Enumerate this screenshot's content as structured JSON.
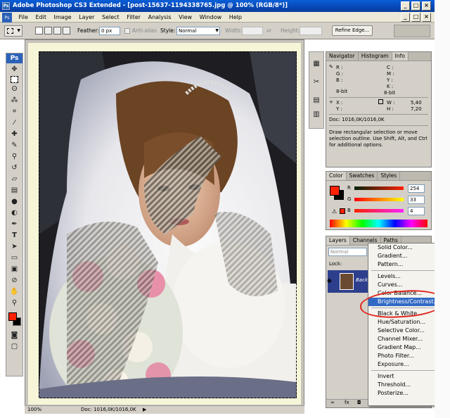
{
  "window": {
    "title": "Adobe Photoshop CS3 Extended - [post-15637-1194338765.jpg @ 100% (RGB/8*)]"
  },
  "menu": [
    "File",
    "Edit",
    "Image",
    "Layer",
    "Select",
    "Filter",
    "Analysis",
    "View",
    "Window",
    "Help"
  ],
  "options": {
    "feather_label": "Feather:",
    "feather_value": "0 px",
    "antialias_label": "Anti-alias",
    "style_label": "Style:",
    "style_value": "Normal",
    "width_label": "Width:",
    "height_label": "Height:",
    "refine_edge": "Refine Edge..."
  },
  "toolbox": {
    "logo": "Ps"
  },
  "status": {
    "zoom": "100%",
    "doc": "Doc: 1016,0K/1016,0K"
  },
  "info_panel": {
    "tabs": [
      "Navigator",
      "Histogram",
      "Info"
    ],
    "rgb": [
      "R :",
      "G :",
      "B :"
    ],
    "cmyk": [
      "C :",
      "M :",
      "Y :",
      "K :"
    ],
    "bit_left": "8-bit",
    "bit_right": "8-bit",
    "x": "X :",
    "y": "Y :",
    "w_label": "W :",
    "h_label": "H :",
    "w_value": "5,40",
    "h_value": "7,20",
    "doc": "Doc: 1016,0K/1016,0K",
    "help": "Draw rectangular selection or move selection outline.  Use Shift, Alt, and Ctrl for additional options."
  },
  "color_panel": {
    "tabs": [
      "Color",
      "Swatches",
      "Styles"
    ],
    "r_label": "R",
    "g_label": "G",
    "b_label": "B",
    "r_value": "254",
    "g_value": "33",
    "b_value": "4",
    "fg_color": "#fe2104"
  },
  "layers_panel": {
    "tabs": [
      "Layers",
      "Channels",
      "Paths"
    ],
    "blend": "Normal",
    "lock_label": "Lock:",
    "layer_name": "Backg"
  },
  "context_menu": {
    "group1": [
      "Solid Color...",
      "Gradient...",
      "Pattern..."
    ],
    "group2": [
      "Levels...",
      "Curves...",
      "Color Balance...",
      "Brightness/Contrast..."
    ],
    "group3": [
      "Black & White...",
      "Hue/Saturation...",
      "Selective Color...",
      "Channel Mixer...",
      "Gradient Map...",
      "Photo Filter...",
      "Exposure..."
    ],
    "group4": [
      "Invert",
      "Threshold...",
      "Posterize..."
    ],
    "highlighted": "Brightness/Contrast..."
  }
}
